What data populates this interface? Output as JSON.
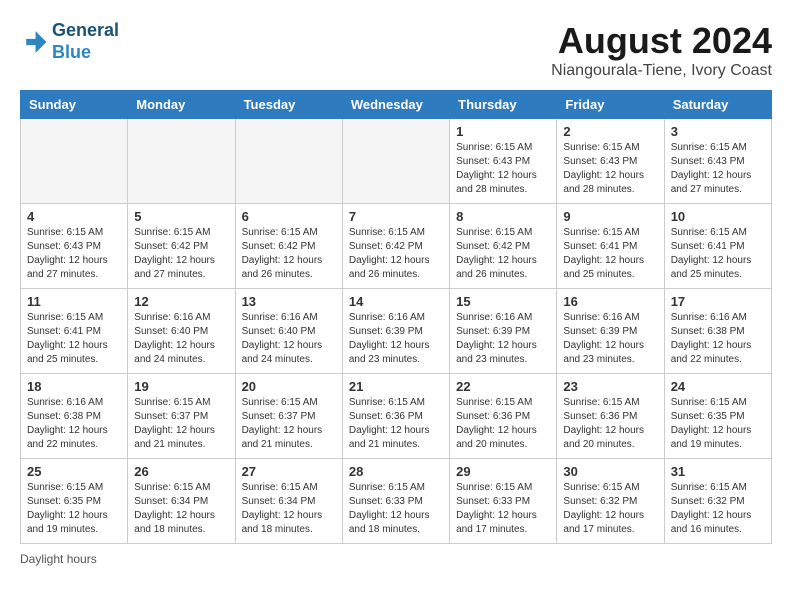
{
  "logo": {
    "line1": "General",
    "line2": "Blue"
  },
  "title": "August 2024",
  "location": "Niangourala-Tiene, Ivory Coast",
  "days": [
    "Sunday",
    "Monday",
    "Tuesday",
    "Wednesday",
    "Thursday",
    "Friday",
    "Saturday"
  ],
  "footer": "Daylight hours",
  "weeks": [
    [
      {
        "date": "",
        "info": ""
      },
      {
        "date": "",
        "info": ""
      },
      {
        "date": "",
        "info": ""
      },
      {
        "date": "",
        "info": ""
      },
      {
        "date": "1",
        "info": "Sunrise: 6:15 AM\nSunset: 6:43 PM\nDaylight: 12 hours\nand 28 minutes."
      },
      {
        "date": "2",
        "info": "Sunrise: 6:15 AM\nSunset: 6:43 PM\nDaylight: 12 hours\nand 28 minutes."
      },
      {
        "date": "3",
        "info": "Sunrise: 6:15 AM\nSunset: 6:43 PM\nDaylight: 12 hours\nand 27 minutes."
      }
    ],
    [
      {
        "date": "4",
        "info": "Sunrise: 6:15 AM\nSunset: 6:43 PM\nDaylight: 12 hours\nand 27 minutes."
      },
      {
        "date": "5",
        "info": "Sunrise: 6:15 AM\nSunset: 6:42 PM\nDaylight: 12 hours\nand 27 minutes."
      },
      {
        "date": "6",
        "info": "Sunrise: 6:15 AM\nSunset: 6:42 PM\nDaylight: 12 hours\nand 26 minutes."
      },
      {
        "date": "7",
        "info": "Sunrise: 6:15 AM\nSunset: 6:42 PM\nDaylight: 12 hours\nand 26 minutes."
      },
      {
        "date": "8",
        "info": "Sunrise: 6:15 AM\nSunset: 6:42 PM\nDaylight: 12 hours\nand 26 minutes."
      },
      {
        "date": "9",
        "info": "Sunrise: 6:15 AM\nSunset: 6:41 PM\nDaylight: 12 hours\nand 25 minutes."
      },
      {
        "date": "10",
        "info": "Sunrise: 6:15 AM\nSunset: 6:41 PM\nDaylight: 12 hours\nand 25 minutes."
      }
    ],
    [
      {
        "date": "11",
        "info": "Sunrise: 6:15 AM\nSunset: 6:41 PM\nDaylight: 12 hours\nand 25 minutes."
      },
      {
        "date": "12",
        "info": "Sunrise: 6:16 AM\nSunset: 6:40 PM\nDaylight: 12 hours\nand 24 minutes."
      },
      {
        "date": "13",
        "info": "Sunrise: 6:16 AM\nSunset: 6:40 PM\nDaylight: 12 hours\nand 24 minutes."
      },
      {
        "date": "14",
        "info": "Sunrise: 6:16 AM\nSunset: 6:39 PM\nDaylight: 12 hours\nand 23 minutes."
      },
      {
        "date": "15",
        "info": "Sunrise: 6:16 AM\nSunset: 6:39 PM\nDaylight: 12 hours\nand 23 minutes."
      },
      {
        "date": "16",
        "info": "Sunrise: 6:16 AM\nSunset: 6:39 PM\nDaylight: 12 hours\nand 23 minutes."
      },
      {
        "date": "17",
        "info": "Sunrise: 6:16 AM\nSunset: 6:38 PM\nDaylight: 12 hours\nand 22 minutes."
      }
    ],
    [
      {
        "date": "18",
        "info": "Sunrise: 6:16 AM\nSunset: 6:38 PM\nDaylight: 12 hours\nand 22 minutes."
      },
      {
        "date": "19",
        "info": "Sunrise: 6:15 AM\nSunset: 6:37 PM\nDaylight: 12 hours\nand 21 minutes."
      },
      {
        "date": "20",
        "info": "Sunrise: 6:15 AM\nSunset: 6:37 PM\nDaylight: 12 hours\nand 21 minutes."
      },
      {
        "date": "21",
        "info": "Sunrise: 6:15 AM\nSunset: 6:36 PM\nDaylight: 12 hours\nand 21 minutes."
      },
      {
        "date": "22",
        "info": "Sunrise: 6:15 AM\nSunset: 6:36 PM\nDaylight: 12 hours\nand 20 minutes."
      },
      {
        "date": "23",
        "info": "Sunrise: 6:15 AM\nSunset: 6:36 PM\nDaylight: 12 hours\nand 20 minutes."
      },
      {
        "date": "24",
        "info": "Sunrise: 6:15 AM\nSunset: 6:35 PM\nDaylight: 12 hours\nand 19 minutes."
      }
    ],
    [
      {
        "date": "25",
        "info": "Sunrise: 6:15 AM\nSunset: 6:35 PM\nDaylight: 12 hours\nand 19 minutes."
      },
      {
        "date": "26",
        "info": "Sunrise: 6:15 AM\nSunset: 6:34 PM\nDaylight: 12 hours\nand 18 minutes."
      },
      {
        "date": "27",
        "info": "Sunrise: 6:15 AM\nSunset: 6:34 PM\nDaylight: 12 hours\nand 18 minutes."
      },
      {
        "date": "28",
        "info": "Sunrise: 6:15 AM\nSunset: 6:33 PM\nDaylight: 12 hours\nand 18 minutes."
      },
      {
        "date": "29",
        "info": "Sunrise: 6:15 AM\nSunset: 6:33 PM\nDaylight: 12 hours\nand 17 minutes."
      },
      {
        "date": "30",
        "info": "Sunrise: 6:15 AM\nSunset: 6:32 PM\nDaylight: 12 hours\nand 17 minutes."
      },
      {
        "date": "31",
        "info": "Sunrise: 6:15 AM\nSunset: 6:32 PM\nDaylight: 12 hours\nand 16 minutes."
      }
    ]
  ]
}
